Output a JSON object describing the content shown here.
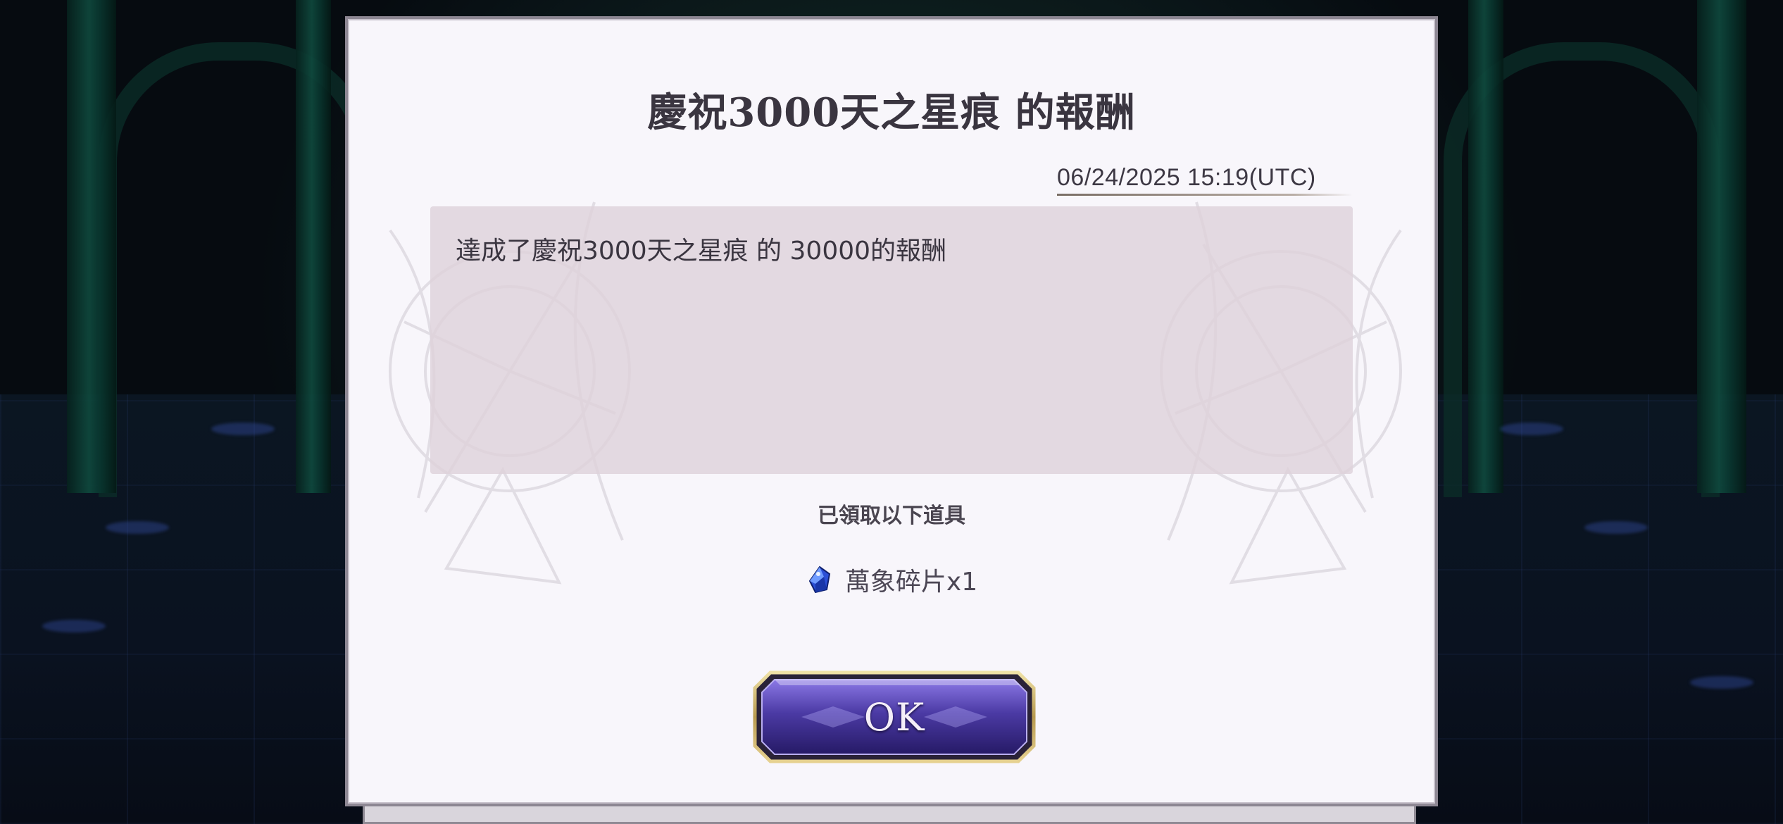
{
  "dialog": {
    "title": "慶祝3000天之星痕 的報酬",
    "date": "06/24/2025 15:19(UTC)",
    "message": "達成了慶祝3000天之星痕 的 30000的報酬",
    "received_label": "已領取以下道具",
    "reward": {
      "icon": "blue-crystal-shard-icon",
      "label": "萬象碎片x1"
    },
    "ok_label": "OK"
  },
  "colors": {
    "dialog_bg": "#f8f6fb",
    "message_box_bg": "#e3d7de",
    "text": "#3a3540",
    "button_purple": "#4a3a9a",
    "button_gold": "#c9b06a"
  }
}
